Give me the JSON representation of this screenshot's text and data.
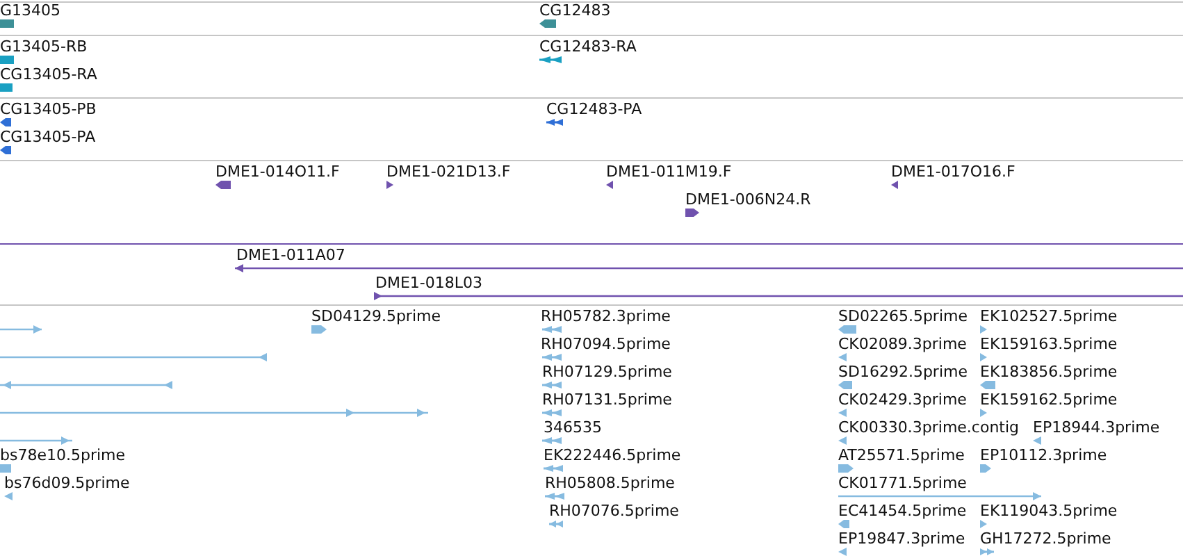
{
  "tracks": [
    {
      "color": "#3d9097",
      "features": [
        {
          "label": "G13405"
        },
        {
          "label": "CG12483",
          "forward": false
        }
      ]
    },
    {
      "color": "#1aa0c2",
      "features": [
        {
          "label": "G13405-RB"
        },
        {
          "label": "CG13405-RA"
        },
        {
          "label": "CG12483-RA",
          "forward": false
        }
      ]
    },
    {
      "color": "#2f6fd6",
      "features": [
        {
          "label": "CG13405-PB",
          "forward": false
        },
        {
          "label": "CG13405-PA",
          "forward": false
        },
        {
          "label": "CG12483-PA",
          "forward": false
        }
      ]
    },
    {
      "color": "#7052ae",
      "features": [
        {
          "label": "DME1-014O11.F",
          "forward": false
        },
        {
          "label": "DME1-021D13.F",
          "forward": true
        },
        {
          "label": "DME1-011M19.F",
          "forward": false
        },
        {
          "label": "DME1-006N24.R",
          "forward": true
        },
        {
          "label": "DME1-017O16.F",
          "forward": false
        }
      ]
    },
    {
      "color": "#7052ae",
      "features": [
        {
          "label": "DME1-011A07",
          "forward": false
        },
        {
          "label": "DME1-018L03",
          "forward": true
        }
      ]
    },
    {
      "color": "#86bbe0",
      "features": [
        {
          "forward": true
        },
        {
          "forward": false
        },
        {
          "forward": false
        },
        {
          "forward": true
        },
        {
          "forward": true
        },
        {
          "label": "bs78e10.5prime"
        },
        {
          "label": "bs76d09.5prime",
          "forward": false
        },
        {
          "label": "SD04129.5prime",
          "forward": true
        },
        {
          "label": "RH05782.3prime",
          "forward": false
        },
        {
          "label": "RH07094.5prime",
          "forward": false
        },
        {
          "label": "RH07129.5prime",
          "forward": false
        },
        {
          "label": "RH07131.5prime",
          "forward": false
        },
        {
          "label": "346535",
          "forward": false
        },
        {
          "label": "EK222446.5prime",
          "forward": false
        },
        {
          "label": "RH05808.5prime",
          "forward": false
        },
        {
          "label": "RH07076.5prime",
          "forward": false
        },
        {
          "label": "SD02265.5prime",
          "forward": false
        },
        {
          "label": "CK02089.3prime",
          "forward": false
        },
        {
          "label": "SD16292.5prime",
          "forward": false
        },
        {
          "label": "CK02429.3prime",
          "forward": false
        },
        {
          "label": "CK00330.3prime.contig",
          "forward": false
        },
        {
          "label": "AT25571.5prime",
          "forward": true
        },
        {
          "label": "CK01771.5prime",
          "forward": true
        },
        {
          "label": "EC41454.5prime",
          "forward": false
        },
        {
          "label": "EP19847.3prime",
          "forward": false
        },
        {
          "label": "EK102527.5prime",
          "forward": true
        },
        {
          "label": "EK159163.5prime",
          "forward": true
        },
        {
          "label": "EK183856.5prime",
          "forward": false
        },
        {
          "label": "EK159162.5prime",
          "forward": true
        },
        {
          "label": "EP18944.3prime",
          "forward": false
        },
        {
          "label": "EP10112.3prime",
          "forward": true
        },
        {
          "label": "EK119043.5prime",
          "forward": true
        },
        {
          "label": "GH17272.5prime",
          "forward": true
        }
      ]
    }
  ]
}
